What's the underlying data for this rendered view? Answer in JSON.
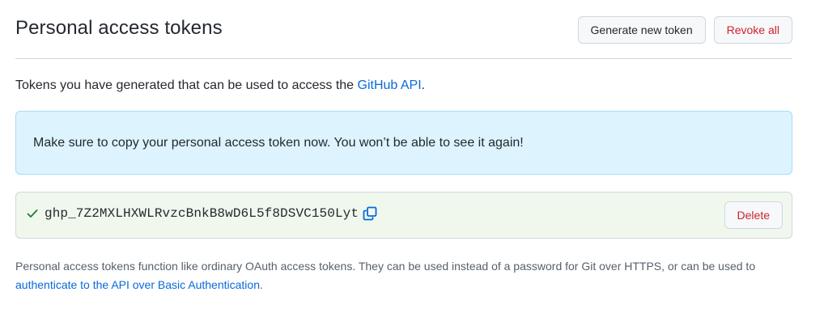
{
  "header": {
    "title": "Personal access tokens",
    "generate_label": "Generate new token",
    "revoke_label": "Revoke all"
  },
  "intro": {
    "text": "Tokens you have generated that can be used to access the ",
    "link": "GitHub API",
    "suffix": "."
  },
  "flash": {
    "message": "Make sure to copy your personal access token now. You won’t be able to see it again!"
  },
  "token": {
    "value": "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",
    "delete_label": "Delete",
    "status_icon": "check-icon",
    "copy_icon": "copy-icon"
  },
  "footer": {
    "text": "Personal access tokens function like ordinary OAuth access tokens. They can be used instead of a password for Git over HTTPS, or can be used to ",
    "link": "authenticate to the API over Basic Authentication",
    "suffix": "."
  },
  "colors": {
    "link": "#0969da",
    "danger": "#cf222e",
    "success": "#1a7f37",
    "flash_bg": "#ddf4ff",
    "token_bg": "#f0f8ee"
  }
}
